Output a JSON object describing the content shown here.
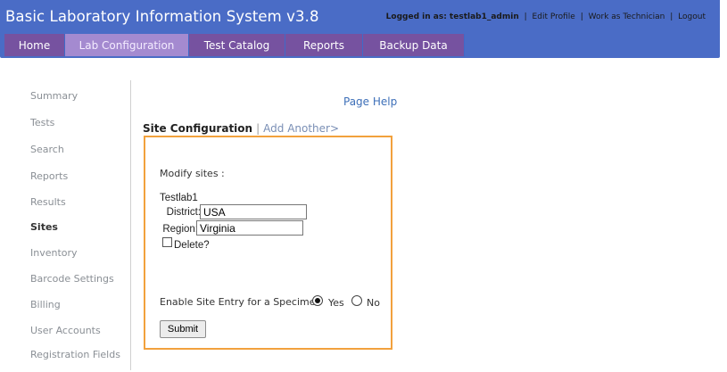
{
  "app": {
    "title": "Basic Laboratory Information System v3.8"
  },
  "user_bar": {
    "logged_in": "Logged in as: testlab1_admin",
    "edit_profile": "Edit Profile",
    "work_as_tech": "Work as Technician",
    "logout": "Logout",
    "separator": "|"
  },
  "nav": {
    "tabs": [
      {
        "label": "Home"
      },
      {
        "label": "Lab Configuration",
        "active": true
      },
      {
        "label": "Test Catalog"
      },
      {
        "label": "Reports"
      },
      {
        "label": "Backup Data"
      }
    ]
  },
  "sidebar": {
    "items": [
      {
        "label": "Summary"
      },
      {
        "label": "Tests"
      },
      {
        "label": "Search"
      },
      {
        "label": "Reports"
      },
      {
        "label": "Results"
      },
      {
        "label": "Sites",
        "active": true
      },
      {
        "label": "Inventory"
      },
      {
        "label": "Barcode Settings"
      },
      {
        "label": "Billing"
      },
      {
        "label": "User Accounts"
      },
      {
        "label": "Registration Fields"
      }
    ]
  },
  "main": {
    "page_help": "Page Help",
    "heading": "Site Configuration",
    "heading_sep": "|",
    "add_another": "Add Another>",
    "modify_label": "Modify sites :",
    "site_name": "Testlab1",
    "district_label": "District:",
    "district_value": "USA",
    "region_label": "Region:",
    "region_value": "Virginia",
    "delete_label": "Delete?",
    "delete_checked": false,
    "enable_label": "Enable Site Entry for a Specimen",
    "yes_label": "Yes",
    "no_label": "No",
    "enable_value": "Yes",
    "submit_label": "Submit"
  },
  "colors": {
    "header": "#4a6cc6",
    "nav_tab": "#7652a0",
    "nav_tab_active": "#a48ad0",
    "panel_border": "#f2a13d",
    "link": "#3d6fb8"
  }
}
